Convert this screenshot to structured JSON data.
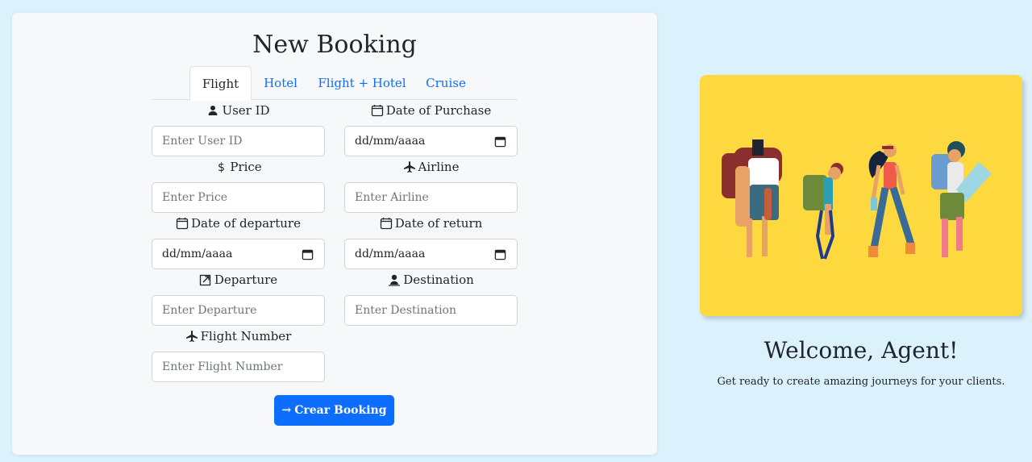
{
  "form": {
    "title": "New Booking",
    "tabs": [
      {
        "label": "Flight",
        "active": true
      },
      {
        "label": "Hotel",
        "active": false
      },
      {
        "label": "Flight + Hotel",
        "active": false
      },
      {
        "label": "Cruise",
        "active": false
      }
    ],
    "fields": {
      "user_id": {
        "label": "User ID",
        "placeholder": "Enter User ID",
        "icon": "user-icon"
      },
      "date_of_purchase": {
        "label": "Date of Purchase",
        "value": "dd/mm/aaaa",
        "icon": "calendar-icon"
      },
      "price": {
        "label": "Price",
        "placeholder": "Enter Price",
        "icon": "dollar-icon"
      },
      "airline": {
        "label": "Airline",
        "placeholder": "Enter Airline",
        "icon": "airplane-icon"
      },
      "date_of_departure": {
        "label": "Date of departure",
        "value": "dd/mm/aaaa",
        "icon": "calendar-icon"
      },
      "date_of_return": {
        "label": "Date of return",
        "value": "dd/mm/aaaa",
        "icon": "calendar-icon"
      },
      "departure": {
        "label": "Departure",
        "placeholder": "Enter Departure",
        "icon": "departure-icon"
      },
      "destination": {
        "label": "Destination",
        "placeholder": "Enter Destination",
        "icon": "location-user-icon"
      },
      "flight_number": {
        "label": "Flight Number",
        "placeholder": "Enter Flight Number",
        "icon": "airplane-icon"
      }
    },
    "submit_label": "Crear Booking",
    "submit_icon": "arrow-right-icon"
  },
  "welcome": {
    "title": "Welcome, Agent!",
    "subtitle": "Get ready to create amazing journeys for your clients.",
    "image_icon": "travelers-illustration"
  },
  "colors": {
    "background": "#dbf2fd",
    "primary": "#0d6efd",
    "hero_bg": "#fdd93f"
  }
}
